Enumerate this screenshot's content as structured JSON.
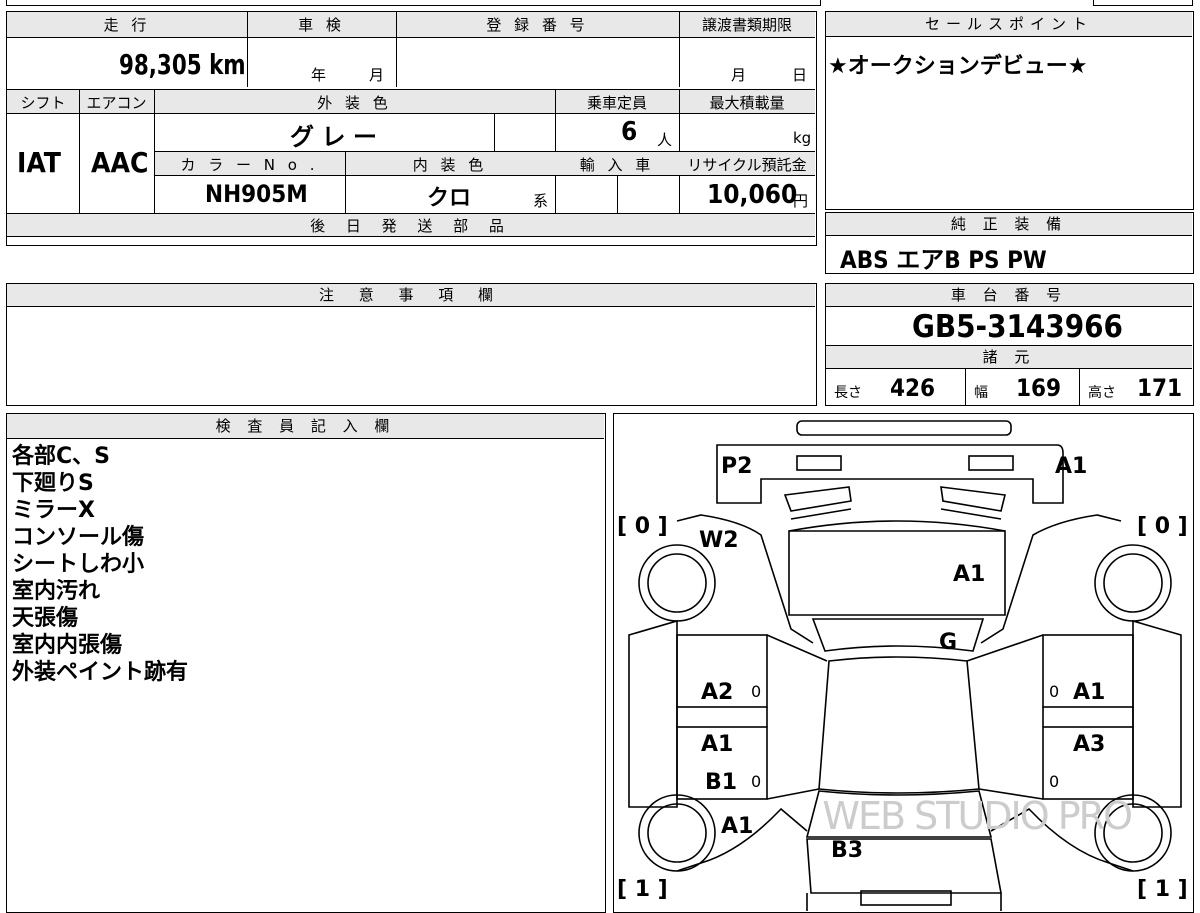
{
  "info": {
    "mileage_label": "走 行",
    "mileage_value": "98,305 km",
    "shaken_label": "車 検",
    "shaken_year": "年",
    "shaken_month": "月",
    "reg_number_label": "登 録 番 号",
    "transfer_deadline_label": "譲渡書類期限",
    "transfer_month": "月",
    "transfer_day": "日",
    "shift_label": "シフト",
    "shift_value": "IAT",
    "aircon_label": "エアコン",
    "aircon_value": "AAC",
    "exterior_color_label": "外 装 色",
    "exterior_color_value": "グ レ ー",
    "capacity_label": "乗車定員",
    "capacity_value": "6",
    "capacity_unit": "人",
    "max_load_label": "最大積載量",
    "max_load_unit": "kg",
    "color_no_label": "カ ラ ー N o .",
    "color_no_value": "NH905M",
    "interior_color_label": "内 装 色",
    "interior_color_value": "クロ",
    "interior_color_suffix": "系",
    "import_label": "輸 入 車",
    "recycle_label": "リサイクル預託金",
    "recycle_value": "10,060",
    "recycle_unit": "円",
    "later_parts_label": "後 日 発 送 部 品",
    "later_parts_value": ""
  },
  "sales_point": {
    "label": "セールスポイント",
    "text": "★オークションデビュー★"
  },
  "standard_equipment": {
    "label": "純 正 装 備",
    "value": "ABS エアB PS PW"
  },
  "notice": {
    "label": "注 意 事 項 欄",
    "text": ""
  },
  "chassis": {
    "label": "車 台 番 号",
    "value": "GB5-3143966"
  },
  "specs": {
    "label": "諸 元",
    "length_label": "長さ",
    "length_value": "426",
    "width_label": "幅",
    "width_value": "169",
    "height_label": "高さ",
    "height_value": "171"
  },
  "inspector": {
    "label": "検 査 員 記 入 欄",
    "notes": [
      "各部C、S",
      "下廻りS",
      "ミラーX",
      "コンソール傷",
      "シートしわ小",
      "室内汚れ",
      "天張傷",
      "室内内張傷",
      "外装ペイント跡有"
    ]
  },
  "diagram": {
    "marks": {
      "front_left": "P2",
      "front_right": "A1",
      "windshield": "W2",
      "hood": "A1",
      "front_glass": "G",
      "left_front_door": "A2",
      "right_front_door": "A1",
      "left_rear_door": "A1",
      "left_rear_door_2": "B1",
      "right_rear_door": "A3",
      "left_rear_fender": "A1",
      "rear": "B3"
    },
    "tires": {
      "front_left": "[ 0 ]",
      "front_right": "[ 0 ]",
      "rear_left": "[ 1 ]",
      "rear_right": "[ 1 ]"
    },
    "door_marks": [
      "0",
      "0",
      "0",
      "0"
    ],
    "watermark": "WEB STUDIO PRO"
  }
}
